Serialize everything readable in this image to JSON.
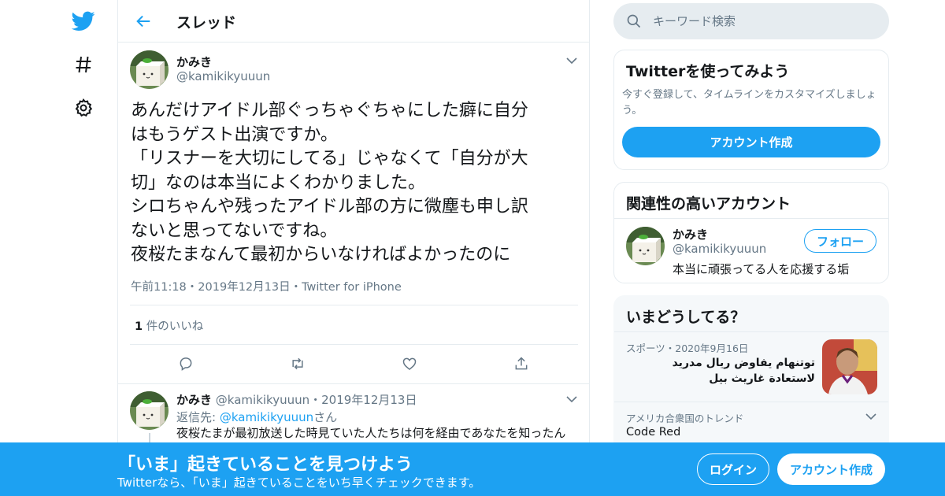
{
  "colors": {
    "accent": "#1da1f2",
    "text": "#14171a",
    "muted": "#657786",
    "border": "#e6ecf0"
  },
  "nav": {
    "items": [
      "twitter-bird-icon",
      "hashtag-icon",
      "gear-icon"
    ]
  },
  "header": {
    "title": "スレッド"
  },
  "tweet": {
    "name": "かみき",
    "handle": "@kamikikyuuun",
    "text": "あんだけアイドル部ぐっちゃぐちゃにした癖に自分\nはもうゲスト出演ですか。\n「リスナーを大切にしてる」じゃなくて「自分が大\n切」なのは本当によくわかりました。\nシロちゃんや残ったアイドル部の方に微塵も申し訳\nないと思ってないですね。\n夜桜たまなんて最初からいなければよかったのに",
    "meta": "午前11:18・2019年12月13日・Twitter for iPhone",
    "likes_count": "1",
    "likes_label": " 件のいいね"
  },
  "reply": {
    "name": "かみき",
    "handle_date": "@kamikikyuuun・2019年12月13日",
    "reply_to_prefix": "返信先: ",
    "reply_to_mention": "@kamikikyuuun",
    "reply_to_suffix": "さん",
    "text": "夜桜たまが最初放送した時見ていた人たちは何を経由であなたを知ったん"
  },
  "search": {
    "placeholder": "キーワード検索"
  },
  "signup_card": {
    "title": "Twitterを使ってみよう",
    "desc": "今すぐ登録して、タイムラインをカスタマイズしましょう。",
    "button": "アカウント作成"
  },
  "related": {
    "title": "関連性の高いアカウント",
    "name": "かみき",
    "handle": "@kamikikyuuun",
    "bio": "本当に頑張ってる人を応援する垢",
    "follow": "フォロー"
  },
  "trends": {
    "title": "いまどうしてる？",
    "item1_meta": "スポーツ・2020年9月16日",
    "item1_line1": "توتنهام يفاوض ريال مدريد",
    "item1_line2": "لاستعادة غاريث بيل",
    "item2_meta": "アメリカ合衆国のトレンド",
    "item2_title": "Code Red"
  },
  "banner": {
    "title": "「いま」起きていることを見つけよう",
    "sub": "Twitterなら、「いま」起きていることをいち早くチェックできます。",
    "login": "ログイン",
    "signup": "アカウント作成"
  }
}
